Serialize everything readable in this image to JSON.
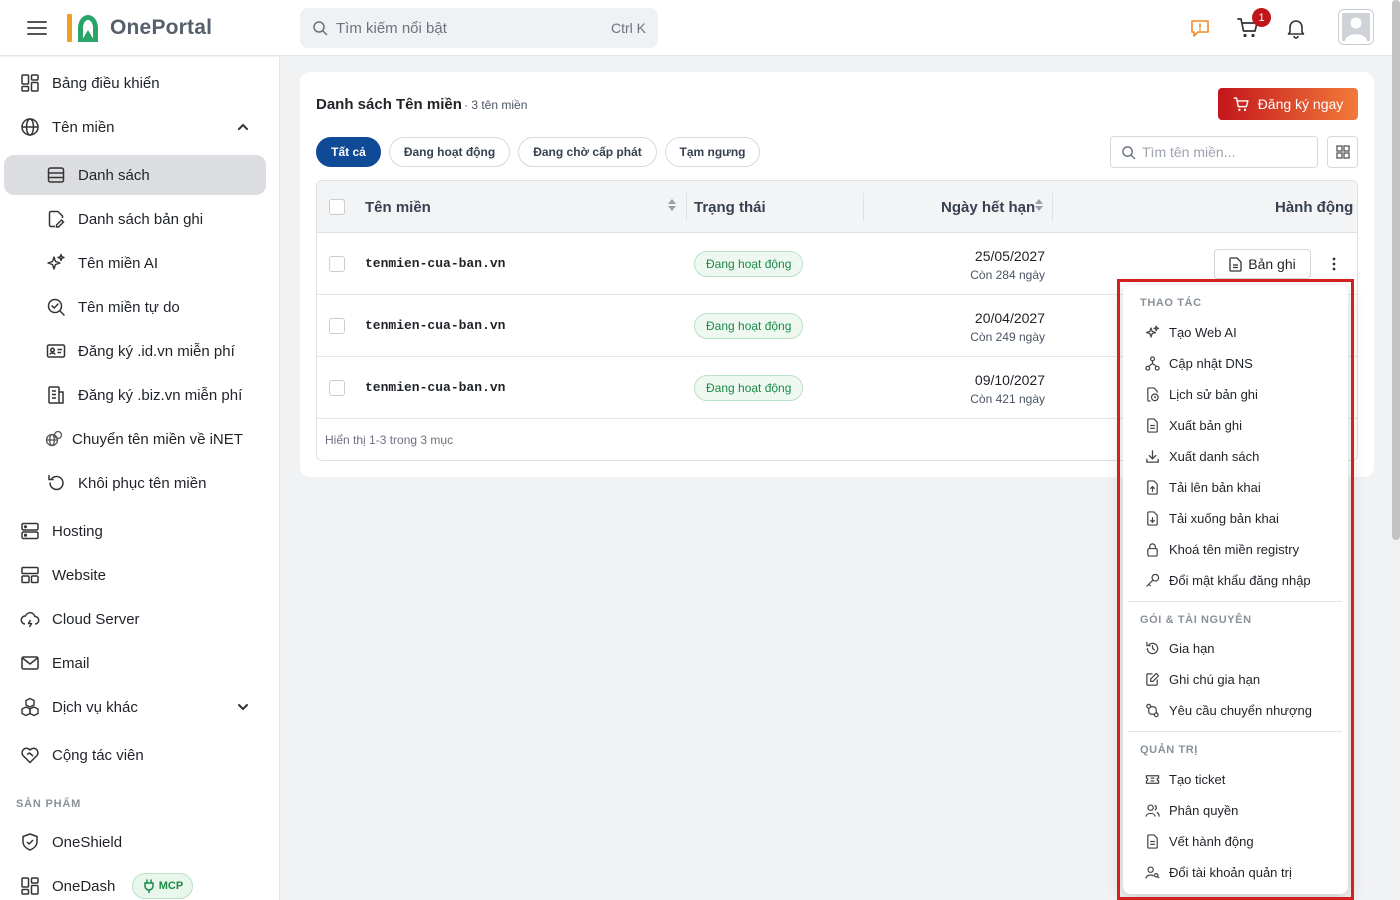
{
  "header": {
    "app_name": "OnePortal",
    "logo_mark": "10",
    "search_placeholder": "Tìm kiếm nổi bật",
    "search_shortcut": "Ctrl K",
    "cart_count": "1"
  },
  "sidebar": {
    "items": [
      {
        "label": "Bảng điều khiển"
      },
      {
        "label": "Tên miền"
      },
      {
        "label": "Danh sách"
      },
      {
        "label": "Danh sách bản ghi"
      },
      {
        "label": "Tên miền AI"
      },
      {
        "label": "Tên miền tự do"
      },
      {
        "label": "Đăng ký .id.vn miễn phí"
      },
      {
        "label": "Đăng ký .biz.vn miễn phí"
      },
      {
        "label": "Chuyển tên miền về iNET"
      },
      {
        "label": "Khôi phục tên miền"
      },
      {
        "label": "Hosting"
      },
      {
        "label": "Website"
      },
      {
        "label": "Cloud Server"
      },
      {
        "label": "Email"
      },
      {
        "label": "Dịch vụ khác"
      },
      {
        "label": "Cộng tác viên"
      }
    ],
    "section_products": "SẢN PHẨM",
    "products": [
      {
        "label": "OneShield"
      },
      {
        "label": "OneDash",
        "badge": "MCP"
      }
    ]
  },
  "main": {
    "title": "Danh sách Tên miền",
    "count": "· 3 tên miền",
    "register_label": "Đăng ký ngay",
    "filters": [
      "Tất cả",
      "Đang hoạt động",
      "Đang chờ cấp phát",
      "Tạm ngưng"
    ],
    "search_placeholder": "Tìm tên miền...",
    "columns": [
      "Tên miền",
      "Trạng thái",
      "Ngày hết hạn",
      "Hành động"
    ],
    "rows": [
      {
        "domain": "tenmien-cua-ban.vn",
        "status": "Đang hoạt động",
        "expiry": "25/05/2027",
        "remaining": "Còn 284 ngày"
      },
      {
        "domain": "tenmien-cua-ban.vn",
        "status": "Đang hoạt động",
        "expiry": "20/04/2027",
        "remaining": "Còn 249 ngày"
      },
      {
        "domain": "tenmien-cua-ban.vn",
        "status": "Đang hoạt động",
        "expiry": "09/10/2027",
        "remaining": "Còn 421 ngày"
      }
    ],
    "record_button": "Bản ghi",
    "footer": "Hiển thị 1-3 trong 3 mục"
  },
  "menu": {
    "sections": [
      {
        "title": "THAO TÁC",
        "items": [
          "Tạo Web AI",
          "Cập nhật DNS",
          "Lịch sử bản ghi",
          "Xuất bản ghi",
          "Xuất danh sách",
          "Tải lên bản khai",
          "Tải xuống bản khai",
          "Khoá tên miền registry",
          "Đổi mật khẩu đăng nhập"
        ]
      },
      {
        "title": "GÓI & TÀI NGUYÊN",
        "items": [
          "Gia hạn",
          "Ghi chú gia hạn",
          "Yêu cầu chuyển nhượng"
        ]
      },
      {
        "title": "QUẢN TRỊ",
        "items": [
          "Tạo ticket",
          "Phân quyền",
          "Vết hành động",
          "Đổi tài khoản quản trị"
        ]
      }
    ]
  },
  "colors": {
    "accent": "#0e4a95",
    "brand_gradient_start": "#c3161c",
    "brand_gradient_end": "#f27a3a",
    "status_green": "#1a8a46",
    "highlight_outline": "#d32020"
  }
}
